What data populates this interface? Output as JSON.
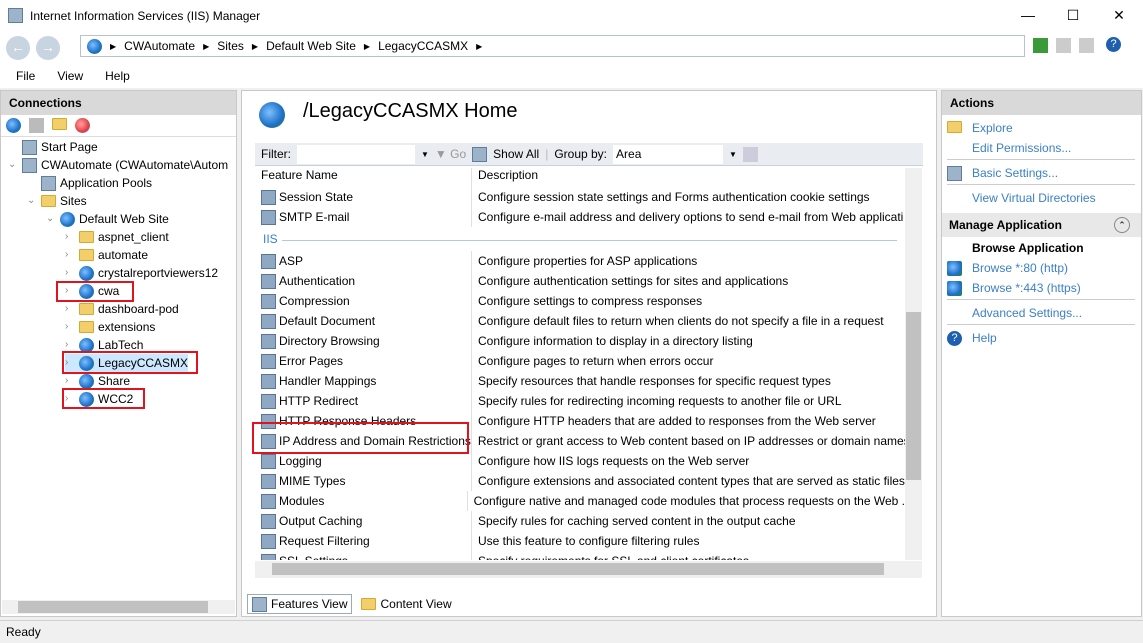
{
  "window": {
    "title": "Internet Information Services (IIS) Manager",
    "minimize": "—",
    "maximize": "☐",
    "close": "✕"
  },
  "address": {
    "crumbs": [
      "CWAutomate",
      "Sites",
      "Default Web Site",
      "LegacyCCASMX"
    ],
    "separator": "▶"
  },
  "menu": [
    "File",
    "View",
    "Help"
  ],
  "connections": {
    "title": "Connections",
    "tree": [
      {
        "label": "Start Page",
        "icon": "start-page-icon",
        "depth": 0
      },
      {
        "label": "CWAutomate (CWAutomate\\Autom",
        "icon": "server-icon",
        "depth": 0
      },
      {
        "label": "Application Pools",
        "icon": "app-pools-icon",
        "depth": 1
      },
      {
        "label": "Sites",
        "icon": "sites-icon",
        "depth": 1
      },
      {
        "label": "Default Web Site",
        "icon": "globe-icon",
        "depth": 2
      },
      {
        "label": "aspnet_client",
        "icon": "folder-icon",
        "depth": 3
      },
      {
        "label": "automate",
        "icon": "folder-icon",
        "depth": 3
      },
      {
        "label": "crystalreportviewers12",
        "icon": "app-icon",
        "depth": 3
      },
      {
        "label": "cwa",
        "icon": "app-icon",
        "depth": 3
      },
      {
        "label": "dashboard-pod",
        "icon": "folder-icon",
        "depth": 3
      },
      {
        "label": "extensions",
        "icon": "folder-icon",
        "depth": 3
      },
      {
        "label": "LabTech",
        "icon": "app-icon",
        "depth": 3
      },
      {
        "label": "LegacyCCASMX",
        "icon": "app-icon",
        "depth": 3
      },
      {
        "label": "Share",
        "icon": "app-icon",
        "depth": 3
      },
      {
        "label": "WCC2",
        "icon": "app-icon",
        "depth": 3
      }
    ]
  },
  "center": {
    "title": "/LegacyCCASMX Home",
    "filter": {
      "label": "Filter:",
      "go": "Go",
      "show_all": "Show All",
      "group_by_label": "Group by:",
      "group_by_value": "Area"
    },
    "columns": [
      "Feature Name",
      "Description"
    ],
    "group_iis": "IIS",
    "rows_top": [
      {
        "name": "Session State",
        "desc": "Configure session state settings and Forms authentication cookie settings"
      },
      {
        "name": "SMTP E-mail",
        "desc": "Configure e-mail address and delivery options to send e-mail from Web applicati"
      }
    ],
    "rows": [
      {
        "name": "ASP",
        "desc": "Configure properties for ASP applications"
      },
      {
        "name": "Authentication",
        "desc": "Configure authentication settings for sites and applications"
      },
      {
        "name": "Compression",
        "desc": "Configure settings to compress responses"
      },
      {
        "name": "Default Document",
        "desc": "Configure default files to return when clients do not specify a file in a request"
      },
      {
        "name": "Directory Browsing",
        "desc": "Configure information to display in a directory listing"
      },
      {
        "name": "Error Pages",
        "desc": "Configure pages to return when errors occur"
      },
      {
        "name": "Handler Mappings",
        "desc": "Specify resources that handle responses for specific request types"
      },
      {
        "name": "HTTP Redirect",
        "desc": "Specify rules for redirecting incoming requests to another file or URL"
      },
      {
        "name": "HTTP Response Headers",
        "desc": "Configure HTTP headers that are added to responses from the Web server"
      },
      {
        "name": "IP Address and Domain Restrictions",
        "desc": "Restrict or grant access to Web content based on IP addresses or domain names"
      },
      {
        "name": "Logging",
        "desc": "Configure how IIS logs requests on the Web server"
      },
      {
        "name": "MIME Types",
        "desc": "Configure extensions and associated content types that are served as static files"
      },
      {
        "name": "Modules",
        "desc": "Configure native and managed code modules that process requests on the Web ."
      },
      {
        "name": "Output Caching",
        "desc": "Specify rules for caching served content in the output cache"
      },
      {
        "name": "Request Filtering",
        "desc": "Use this feature to configure filtering rules"
      },
      {
        "name": "SSL Settings",
        "desc": "Specify requirements for SSL and client certificates"
      }
    ],
    "tabs": [
      "Features View",
      "Content View"
    ]
  },
  "actions": {
    "title": "Actions",
    "explore": "Explore",
    "edit_permissions": "Edit Permissions...",
    "basic_settings": "Basic Settings...",
    "view_vdirs": "View Virtual Directories",
    "manage_app": "Manage Application",
    "browse_app": "Browse Application",
    "browse80": "Browse *:80 (http)",
    "browse443": "Browse *:443 (https)",
    "advanced": "Advanced Settings...",
    "help": "Help"
  },
  "status": "Ready"
}
